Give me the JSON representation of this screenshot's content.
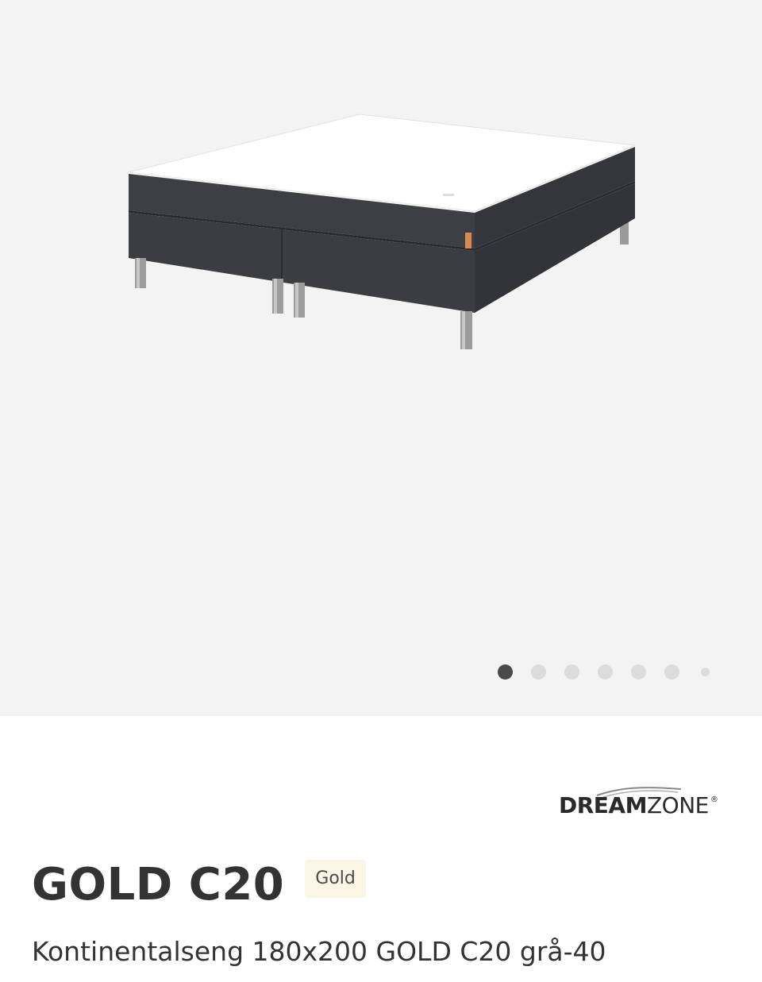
{
  "gallery": {
    "image_alt": "Kontinentalseng 180x200 GOLD C20 grå-40",
    "dots_count": 7,
    "active_index": 0
  },
  "brand": {
    "name_bold": "DREAM",
    "name_regular": "ZONE",
    "registered_mark": "®"
  },
  "product": {
    "title": "GOLD C20",
    "badge": "Gold",
    "subtitle": "Kontinentalseng 180x200 GOLD C20 grå-40"
  },
  "colors": {
    "gallery_bg": "#f3f3f3",
    "fabric": "#3d3f44",
    "badge_bg": "#fbf5e6",
    "dot_active": "#4a4a4a",
    "dot_inactive": "#dcdcdc"
  }
}
